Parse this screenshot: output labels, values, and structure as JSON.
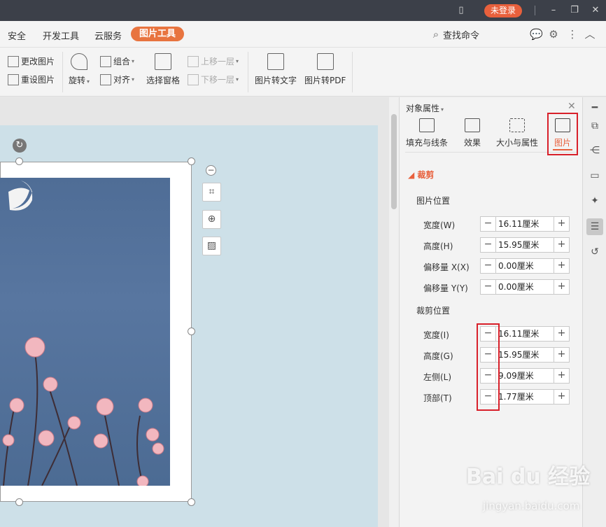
{
  "titlebar": {
    "login": "未登录"
  },
  "menubar": {
    "tabs": [
      "安全",
      "开发工具",
      "云服务",
      "图片工具"
    ],
    "search": "查找命令"
  },
  "ribbon": {
    "change_picture": "更改图片",
    "reset_picture": "重设图片",
    "rotate": "旋转",
    "group": "组合",
    "align": "对齐",
    "selection_pane": "选择窗格",
    "bring_forward": "上移一层",
    "send_backward": "下移一层",
    "pic_to_text": "图片转文字",
    "pic_to_pdf": "图片转PDF"
  },
  "panel": {
    "title": "对象属性",
    "tabs": [
      "填充与线条",
      "效果",
      "大小与属性",
      "图片"
    ],
    "section": "裁剪",
    "picture_position": {
      "heading": "图片位置",
      "rows": [
        {
          "label": "宽度(W)",
          "value": "16.11厘米"
        },
        {
          "label": "高度(H)",
          "value": "15.95厘米"
        },
        {
          "label": "偏移量 X(X)",
          "value": "0.00厘米"
        },
        {
          "label": "偏移量 Y(Y)",
          "value": "0.00厘米"
        }
      ]
    },
    "crop_position": {
      "heading": "裁剪位置",
      "rows": [
        {
          "label": "宽度(I)",
          "value": "16.11厘米"
        },
        {
          "label": "高度(G)",
          "value": "15.95厘米"
        },
        {
          "label": "左侧(L)",
          "value": "9.09厘米"
        },
        {
          "label": "顶部(T)",
          "value": "1.77厘米"
        }
      ]
    }
  },
  "watermark": {
    "brand": "Bai du 经验",
    "url": "jingyan.baidu.com"
  },
  "colors": {
    "accent": "#e8603c",
    "highlight": "#d8202a",
    "titlebar": "#3c4049"
  }
}
